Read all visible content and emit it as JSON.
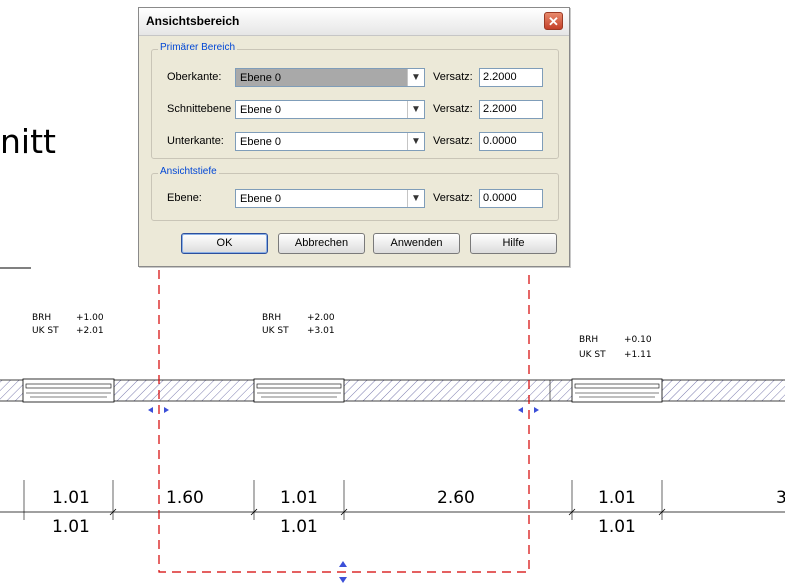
{
  "background": {
    "title_fragment": "nitt",
    "rooms": [
      {
        "brh_label": "BRH",
        "brh_value": "+1.00",
        "ukst_label": "UK ST",
        "ukst_value": "+2.01"
      },
      {
        "brh_label": "BRH",
        "brh_value": "+2.00",
        "ukst_label": "UK ST",
        "ukst_value": "+3.01"
      },
      {
        "brh_label": "BRH",
        "brh_value": "+0.10",
        "ukst_label": "UK ST",
        "ukst_value": "+1.11"
      }
    ],
    "dimensions_top": [
      "1.01",
      "1.60",
      "1.01",
      "2.60",
      "1.01",
      "3"
    ],
    "dimensions_bottom": [
      "1.01",
      "1.01",
      "1.01"
    ]
  },
  "dialog": {
    "title": "Ansichtsbereich",
    "primary_group": {
      "legend": "Primärer Bereich",
      "rows": [
        {
          "label": "Oberkante:",
          "level": "Ebene 0",
          "offset_label": "Versatz:",
          "offset": "2.2000"
        },
        {
          "label": "Schnittebene",
          "level": "Ebene 0",
          "offset_label": "Versatz:",
          "offset": "2.2000"
        },
        {
          "label": "Unterkante:",
          "level": "Ebene 0",
          "offset_label": "Versatz:",
          "offset": "0.0000"
        }
      ]
    },
    "depth_group": {
      "legend": "Ansichtstiefe",
      "row": {
        "label": "Ebene:",
        "level": "Ebene 0",
        "offset_label": "Versatz:",
        "offset": "0.0000"
      }
    },
    "buttons": {
      "ok": "OK",
      "cancel": "Abbrechen",
      "apply": "Anwenden",
      "help": "Hilfe"
    }
  },
  "colors": {
    "crop_region": "#d40000",
    "grip": "#3b4fd8",
    "hatch": "#5a5a9a"
  }
}
